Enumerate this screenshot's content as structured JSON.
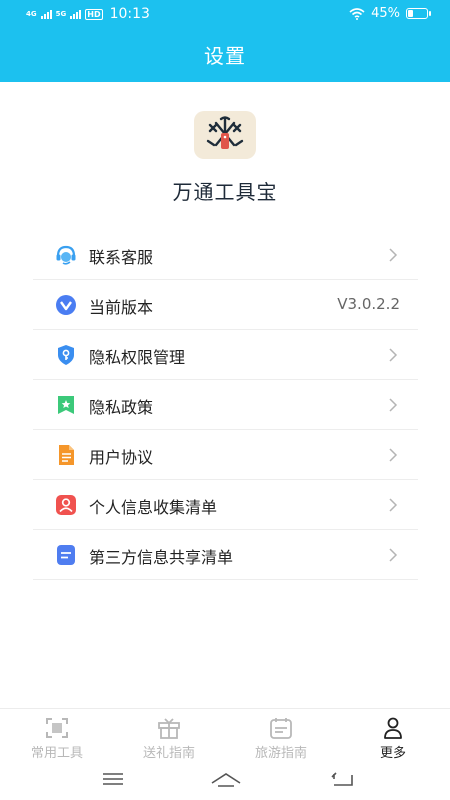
{
  "status_bar": {
    "network_1": "4G",
    "network_2": "5G",
    "hd": "HD",
    "time": "10:13",
    "battery": "45%"
  },
  "header": {
    "title": "设置"
  },
  "app": {
    "name": "万通工具宝",
    "logo_icon": "tools-logo-icon"
  },
  "menu": [
    {
      "label": "联系客服",
      "icon": "customer-service-icon",
      "color": "#3aa0f0"
    },
    {
      "label": "当前版本",
      "icon": "version-icon",
      "color": "#4a7df2",
      "value": "V3.0.2.2"
    },
    {
      "label": "隐私权限管理",
      "icon": "privacy-permission-icon",
      "color": "#3a8ef0"
    },
    {
      "label": "隐私政策",
      "icon": "privacy-policy-icon",
      "color": "#3cc97a"
    },
    {
      "label": "用户协议",
      "icon": "user-agreement-icon",
      "color": "#f5962a"
    },
    {
      "label": "个人信息收集清单",
      "icon": "personal-info-icon",
      "color": "#f0524f"
    },
    {
      "label": "第三方信息共享清单",
      "icon": "third-party-share-icon",
      "color": "#4f7df0"
    }
  ],
  "bottom_nav": [
    {
      "label": "常用工具",
      "icon": "scan-tools-icon",
      "active": false
    },
    {
      "label": "送礼指南",
      "icon": "gift-icon",
      "active": false
    },
    {
      "label": "旅游指南",
      "icon": "calendar-icon",
      "active": false
    },
    {
      "label": "更多",
      "icon": "user-icon",
      "active": true
    }
  ],
  "colors": {
    "header_bg": "#1cc1ef",
    "accent": "#1cc1ef"
  }
}
